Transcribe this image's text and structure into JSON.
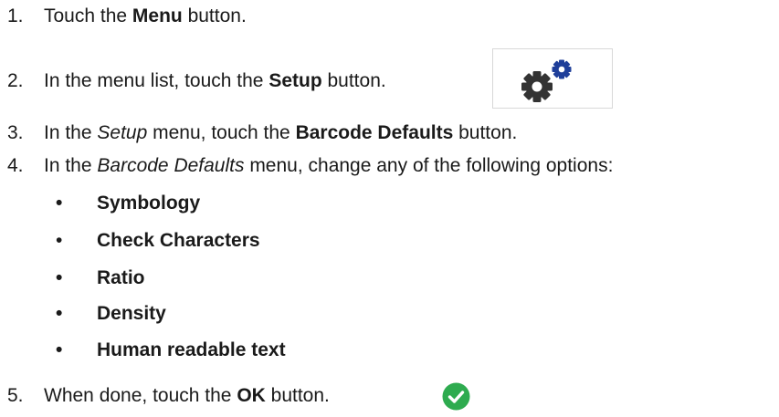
{
  "steps": [
    {
      "num": "1.",
      "pre": "Touch the ",
      "bold": "Menu",
      "post": " button."
    },
    {
      "num": "2.",
      "pre": "In the menu list, touch the ",
      "bold": "Setup",
      "post": " button."
    },
    {
      "num": "3.",
      "pre": "In the ",
      "italic": "Setup",
      "mid": " menu, touch the ",
      "bold": "Barcode Defaults",
      "post": " button."
    },
    {
      "num": "4.",
      "pre": "In the ",
      "italic": "Barcode Defaults",
      "post": " menu, change any of the following options:"
    },
    {
      "num": "5.",
      "pre": "When done, touch the ",
      "bold": "OK",
      "post": " button."
    }
  ],
  "options": [
    {
      "bullet": "•",
      "label": "Symbology"
    },
    {
      "bullet": "•",
      "label": "Check Characters"
    },
    {
      "bullet": "•",
      "label": "Ratio"
    },
    {
      "bullet": "•",
      "label": "Density"
    },
    {
      "bullet": "•",
      "label": "Human readable text"
    }
  ],
  "icons": {
    "setup": "setup-gears-icon",
    "ok": "ok-checkmark-icon"
  },
  "colors": {
    "text": "#1a1a1a",
    "gear_dark": "#333333",
    "gear_blue": "#1f3f9a",
    "ok_green": "#2eab4f"
  }
}
